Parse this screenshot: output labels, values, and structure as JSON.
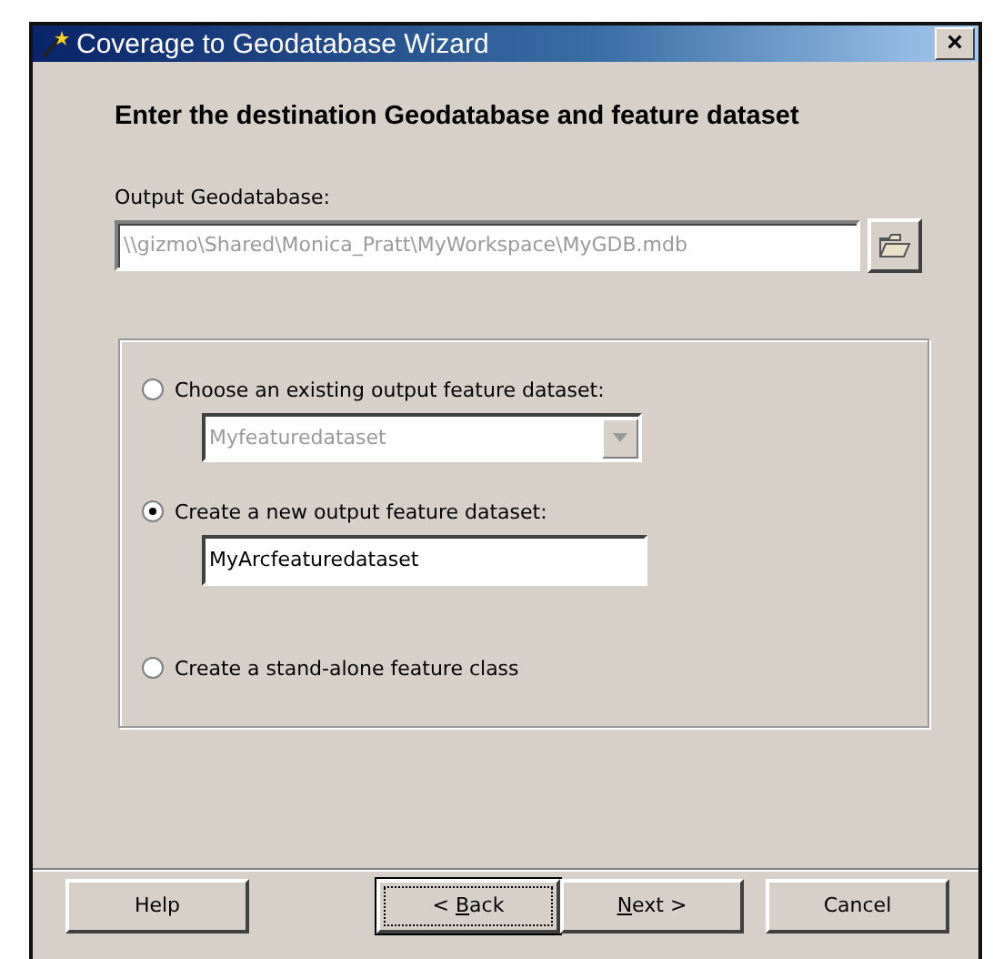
{
  "window": {
    "title": "Coverage to Geodatabase Wizard",
    "close": "×"
  },
  "heading": "Enter the destination Geodatabase and feature dataset",
  "output_geodatabase": {
    "label": "Output Geodatabase:",
    "value": "\\\\gizmo\\Shared\\Monica_Pratt\\MyWorkspace\\MyGDB.mdb",
    "disabled": true
  },
  "options": [
    {
      "label": "Choose an existing output feature dataset:",
      "selected": false,
      "kind": "dropdown",
      "value": "Myfeaturedataset",
      "disabled": true
    },
    {
      "label": "Create a new output feature dataset:",
      "selected": true,
      "kind": "text",
      "value": "MyArcfeaturedataset",
      "disabled": false
    },
    {
      "label": "Create a stand-alone feature class",
      "selected": false,
      "kind": "none"
    }
  ],
  "buttons": [
    {
      "label": "Help",
      "focused": false
    },
    {
      "label_before": "< ",
      "access_key": "B",
      "label_after": "ack",
      "focused": true
    },
    {
      "access_key": "N",
      "label_after": "ext >",
      "focused": false
    },
    {
      "label": "Cancel",
      "focused": false
    }
  ]
}
